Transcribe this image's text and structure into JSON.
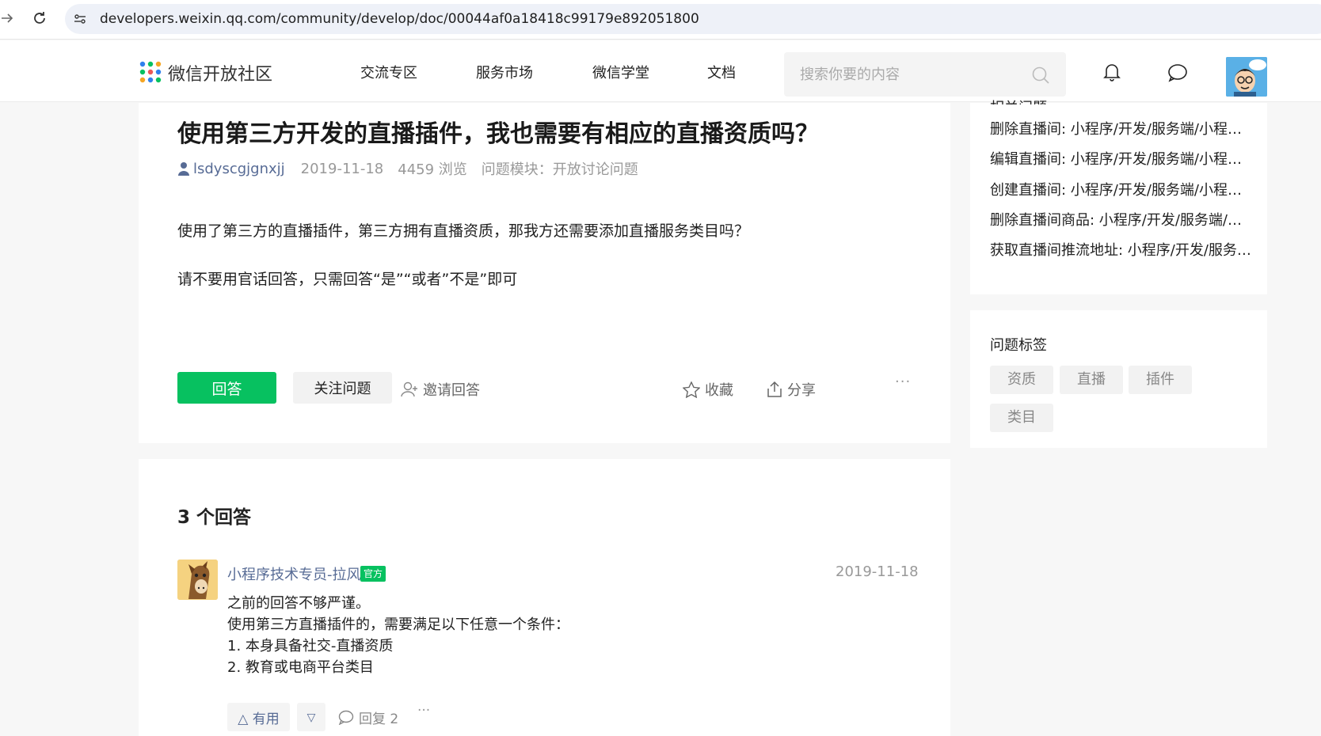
{
  "browser": {
    "url": "developers.weixin.qq.com/community/develop/doc/00044af0a18418c99179e892051800"
  },
  "header": {
    "brand": "微信开放社区",
    "nav": [
      "交流专区",
      "服务市场",
      "微信学堂",
      "文档"
    ],
    "search_placeholder": "搜索你要的内容"
  },
  "question": {
    "title": "使用第三方开发的直播插件，我也需要有相应的直播资质吗？",
    "author": "lsdyscgjgnxjj",
    "date": "2019-11-18",
    "views": "4459 浏览",
    "module_label": "问题模块：",
    "module": "开放讨论问题",
    "body": [
      "使用了第三方的直播插件，第三方拥有直播资质，那我方还需要添加直播服务类目吗？",
      "请不要用官话回答，只需回答“是”“或者”不是”即可"
    ],
    "actions": {
      "answer": "回答",
      "follow": "关注问题",
      "invite": "邀请回答",
      "collect": "收藏",
      "share": "分享",
      "more": "···"
    }
  },
  "answers": {
    "count_label": "3 个回答",
    "items": [
      {
        "author": "小程序技术专员-拉风",
        "badge": "官方",
        "date": "2019-11-18",
        "lines": [
          "之前的回答不够严谨。",
          "使用第三方直播插件的，需要满足以下任意一个条件：",
          "1. 本身具备社交-直播资质",
          "2. 教育或电商平台类目"
        ],
        "useful": "△ 有用",
        "down": "▽",
        "reply": "回复 2",
        "more": "···"
      }
    ]
  },
  "sidebar": {
    "related_title_clipped": "相关问题",
    "related": [
      "删除直播间: 小程序/开发/服务端/小程序直播/直播间管理",
      "编辑直播间: 小程序/开发/服务端/小程序直播/直播间管理",
      "创建直播间: 小程序/开发/服务端/小程序直播/直播间管理",
      "删除直播间商品: 小程序/开发/服务端/小程序直播",
      "获取直播间推流地址: 小程序/开发/服务端/小程序直播"
    ],
    "tags_title": "问题标签",
    "tags": [
      "资质",
      "直播",
      "插件",
      "类目"
    ]
  },
  "colors": {
    "primary_green": "#07c160",
    "link_blue": "#576b95"
  }
}
